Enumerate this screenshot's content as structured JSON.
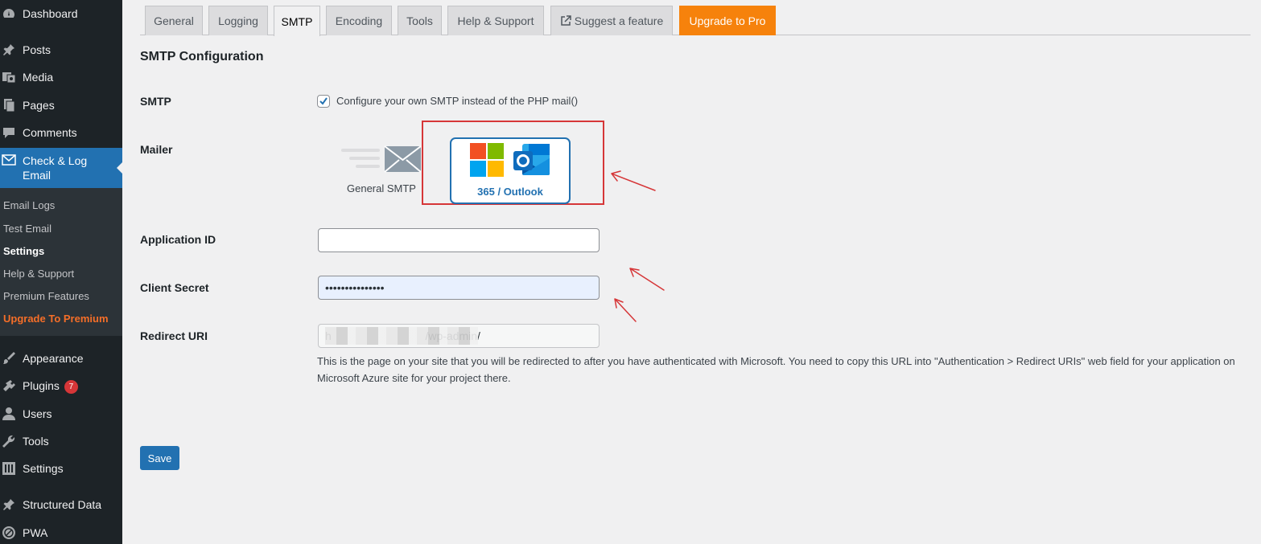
{
  "sidebar": {
    "top_items": [
      {
        "label": "Dashboard",
        "icon": "dashboard-icon"
      },
      {
        "label": "Posts",
        "icon": "pushpin-icon"
      },
      {
        "label": "Media",
        "icon": "media-icon"
      },
      {
        "label": "Pages",
        "icon": "pages-icon"
      },
      {
        "label": "Comments",
        "icon": "comment-icon"
      }
    ],
    "active_item": {
      "label_line1": "Check & Log",
      "label_line2": "Email",
      "icon": "envelope-icon"
    },
    "submenu": [
      {
        "label": "Email Logs"
      },
      {
        "label": "Test Email"
      },
      {
        "label": "Settings"
      },
      {
        "label": "Help & Support"
      },
      {
        "label": "Premium Features"
      },
      {
        "label": "Upgrade To Premium"
      }
    ],
    "bottom_items": [
      {
        "label": "Appearance",
        "icon": "brush-icon"
      },
      {
        "label": "Plugins",
        "icon": "plugin-icon",
        "badge": "7"
      },
      {
        "label": "Users",
        "icon": "user-icon"
      },
      {
        "label": "Tools",
        "icon": "wrench-icon"
      },
      {
        "label": "Settings",
        "icon": "settings-icon"
      },
      {
        "label": "Structured Data",
        "icon": "pushpin-icon"
      },
      {
        "label": "PWA",
        "icon": "pwa-icon"
      }
    ]
  },
  "tabs": [
    {
      "label": "General"
    },
    {
      "label": "Logging"
    },
    {
      "label": "SMTP"
    },
    {
      "label": "Encoding"
    },
    {
      "label": "Tools"
    },
    {
      "label": "Help & Support"
    },
    {
      "label": "Suggest a feature"
    },
    {
      "label": "Upgrade to Pro"
    }
  ],
  "section_title": "SMTP Configuration",
  "form": {
    "smtp_label": "SMTP",
    "smtp_checkbox_label": "Configure your own SMTP instead of the PHP mail()",
    "smtp_checked": true,
    "mailer_label": "Mailer",
    "mailer_general": "General SMTP",
    "mailer_outlook": "365 / Outlook",
    "app_id_label": "Application ID",
    "app_id_value": "",
    "client_secret_label": "Client Secret",
    "client_secret_value": "•••••••••••••••",
    "redirect_label": "Redirect URI",
    "redirect_value": "h                              /wp-admin/",
    "redirect_desc": "This is the page on your site that you will be redirected to after you have authenticated with Microsoft. You need to copy this URL into \"Authentication > Redirect URIs\" web field for your application on Microsoft Azure site for your project there."
  },
  "save_label": "Save",
  "colors": {
    "sidebar_bg": "#1d2327",
    "accent": "#2271b1",
    "pro_tab": "#f6820c",
    "annotation_red": "#d63638"
  }
}
